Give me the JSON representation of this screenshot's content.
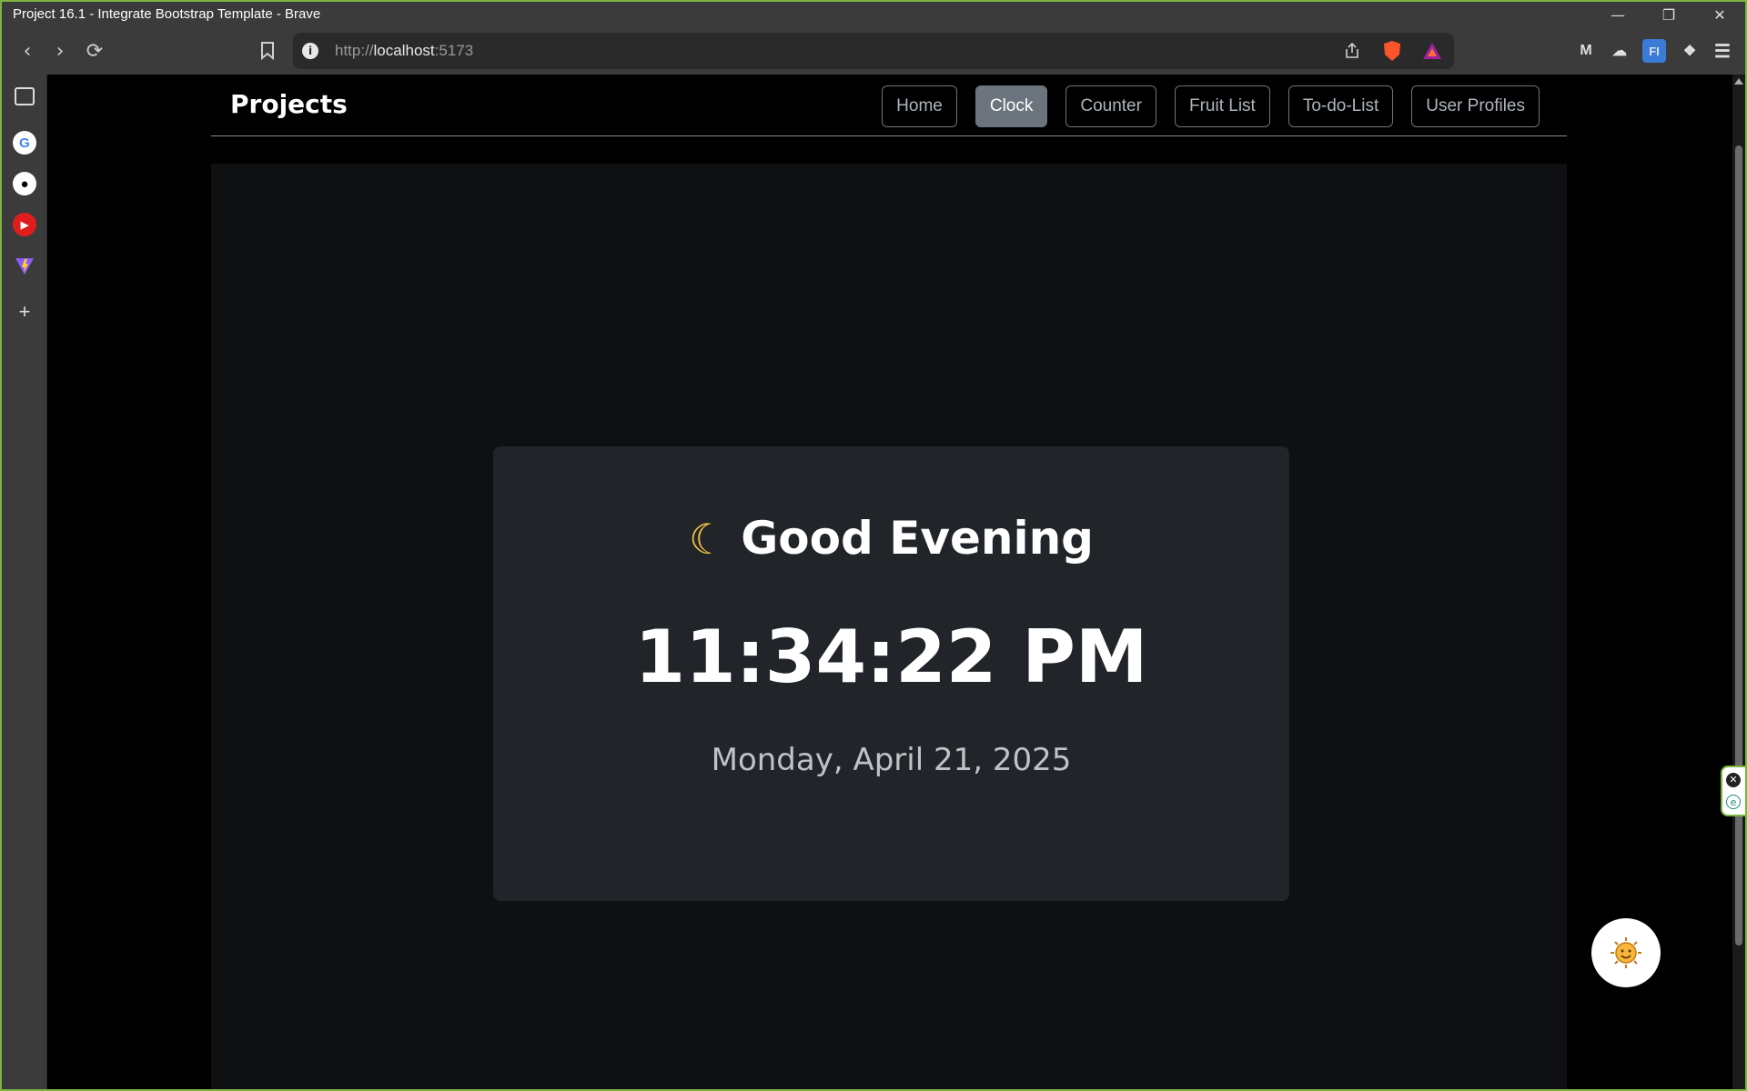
{
  "browser": {
    "window_title": "Project 16.1 - Integrate Bootstrap Template - Brave",
    "url_prefix": "http://",
    "url_host": "localhost",
    "url_port": ":5173"
  },
  "navbar": {
    "brand": "Projects",
    "links": [
      {
        "label": "Home",
        "active": false
      },
      {
        "label": "Clock",
        "active": true
      },
      {
        "label": "Counter",
        "active": false
      },
      {
        "label": "Fruit List",
        "active": false
      },
      {
        "label": "To-do-List",
        "active": false
      },
      {
        "label": "User Profiles",
        "active": false
      }
    ]
  },
  "clock": {
    "greeting_icon": "moon-icon",
    "greeting": "Good Evening",
    "time": "11:34:22 PM",
    "date": "Monday, April 21, 2025"
  },
  "colors": {
    "page_bg": "#000000",
    "main_bg": "#0f1011",
    "card_bg": "#212529",
    "active_link": "#6c757d",
    "window_border": "#7cb342"
  }
}
